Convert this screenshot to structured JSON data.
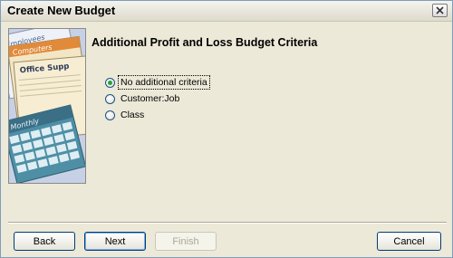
{
  "window": {
    "title": "Create New Budget"
  },
  "sidebar_art": {
    "labels": [
      "Employees",
      "Computers",
      "Office Supp",
      "Monthly"
    ]
  },
  "main": {
    "heading": "Additional Profit and Loss Budget Criteria",
    "options": [
      {
        "label": "No additional criteria",
        "checked": true
      },
      {
        "label": "Customer:Job",
        "checked": false
      },
      {
        "label": "Class",
        "checked": false
      }
    ]
  },
  "footer": {
    "back_label": "Back",
    "next_label": "Next",
    "finish_label": "Finish",
    "cancel_label": "Cancel"
  }
}
